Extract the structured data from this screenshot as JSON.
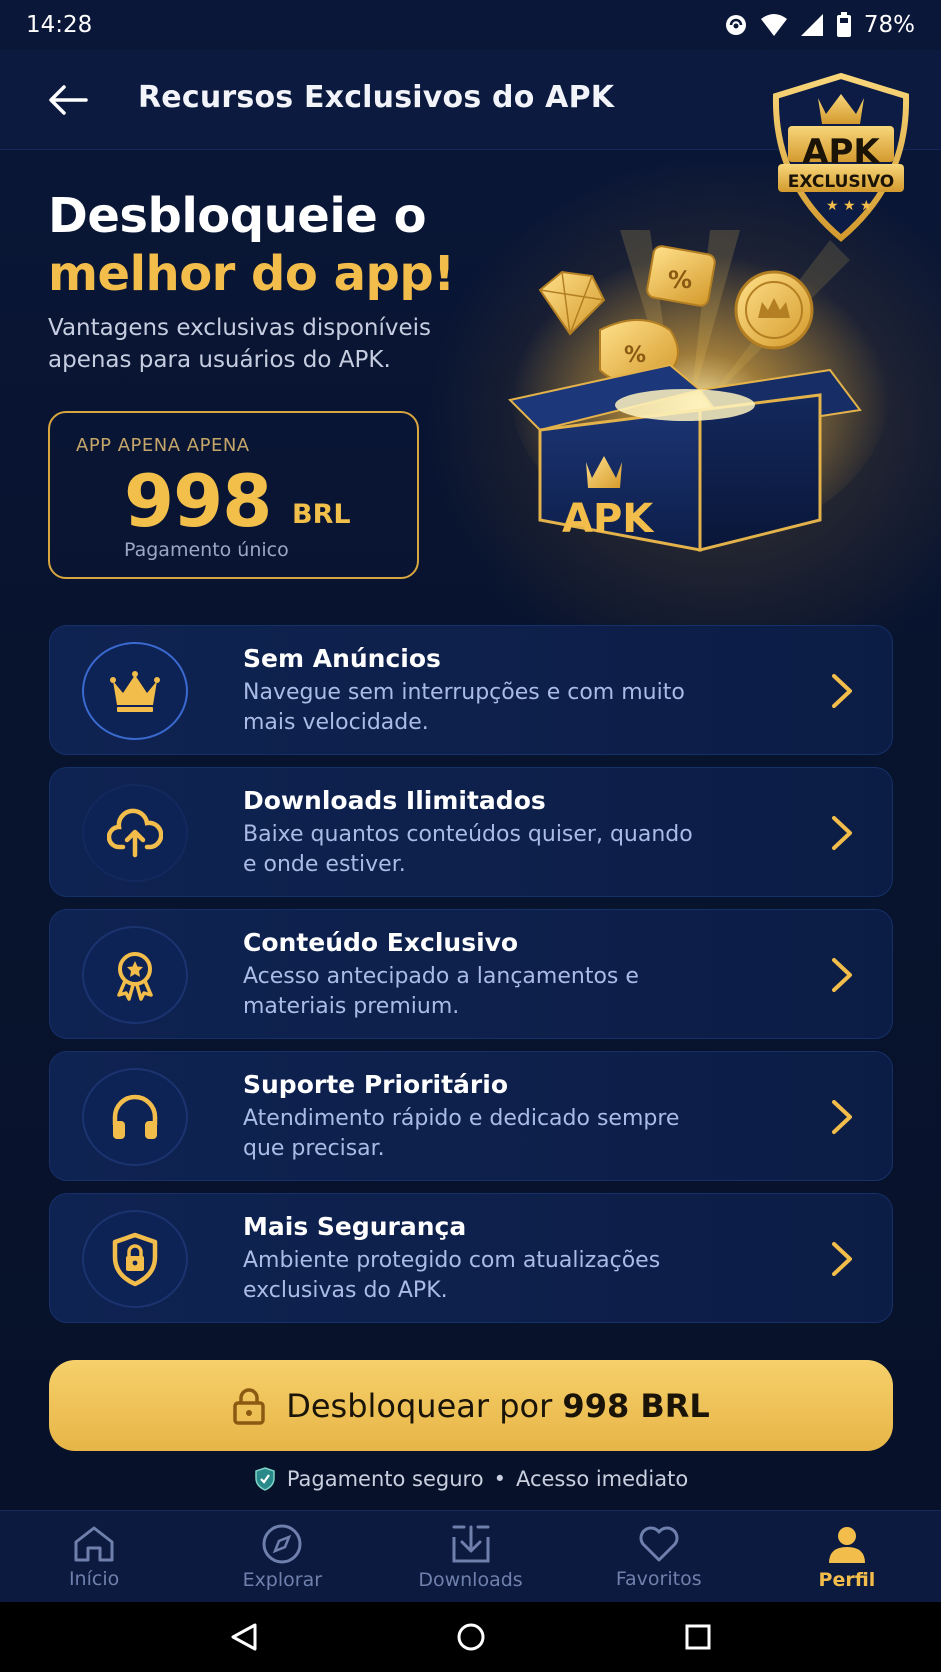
{
  "status_bar": {
    "time": "14:28",
    "battery": "78%"
  },
  "header": {
    "title": "Recursos Exclusivos do APK"
  },
  "badge": {
    "top": "APK",
    "bottom": "EXCLUSIVO"
  },
  "hero": {
    "title_line1": "Desbloqueie o",
    "title_line2": "melhor do app!",
    "subtitle": "Vantagens exclusivas disponíveis apenas para usuários do APK.",
    "box_label": "APK"
  },
  "price_card": {
    "top_label": "APP APENA APENA",
    "value": "998",
    "currency": "BRL",
    "note": "Pagamento único"
  },
  "features": [
    {
      "title": "Sem Anúncios",
      "description": "Navegue sem interrupções e com muito mais velocidade.",
      "icon": "crown-icon"
    },
    {
      "title": "Downloads Ilimitados",
      "description": "Baixe quantos conteúdos quiser, quando e onde estiver.",
      "icon": "cloud-upload-icon"
    },
    {
      "title": "Conteúdo Exclusivo",
      "description": "Acesso antecipado a lançamentos e materiais premium.",
      "icon": "award-icon"
    },
    {
      "title": "Suporte Prioritário",
      "description": "Atendimento rápido e dedicado sempre que precisar.",
      "icon": "headphones-icon"
    },
    {
      "title": "Mais Segurança",
      "description": "Ambiente protegido com atualizações exclusivas do APK.",
      "icon": "shield-lock-icon"
    }
  ],
  "cta": {
    "label_prefix": "Desbloquear por",
    "label_amount": "998 BRL"
  },
  "secure_note": {
    "left": "Pagamento seguro",
    "separator": "•",
    "right": "Acesso imediato"
  },
  "bottom_nav": [
    {
      "label": "Início",
      "icon": "home-icon"
    },
    {
      "label": "Explorar",
      "icon": "compass-icon"
    },
    {
      "label": "Downloads",
      "icon": "download-icon"
    },
    {
      "label": "Favoritos",
      "icon": "heart-icon"
    },
    {
      "label": "Perfil",
      "icon": "user-icon",
      "active": true
    }
  ],
  "colors": {
    "accent_gold": "#f2bd4a",
    "background": "#08142f",
    "card": "#0f2352",
    "muted_text": "#a9bbe6"
  }
}
